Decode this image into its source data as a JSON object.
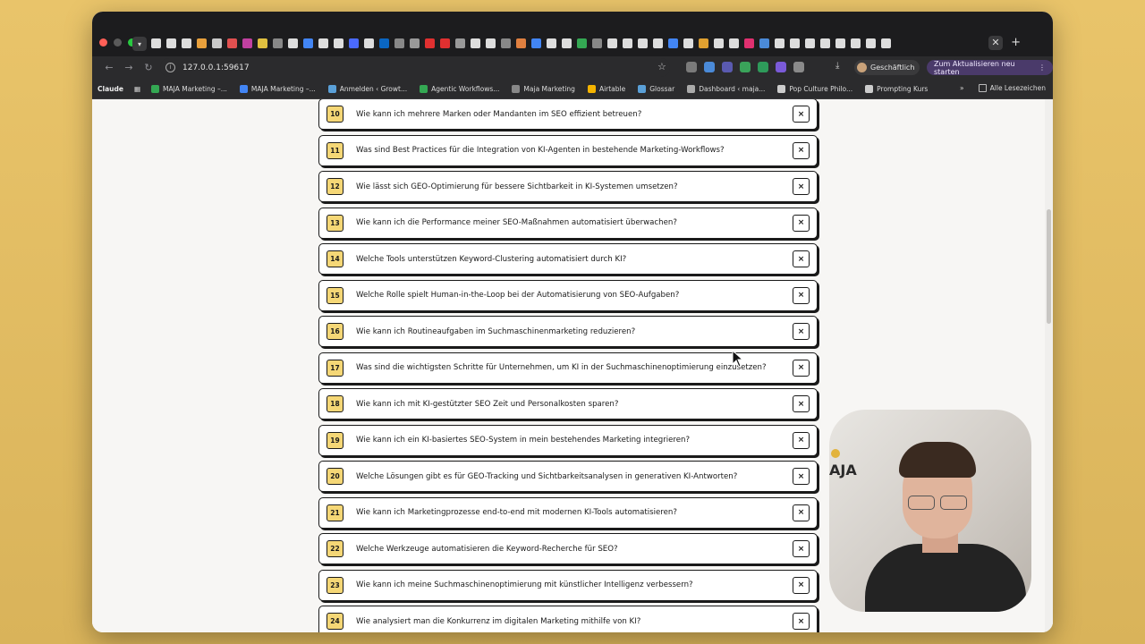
{
  "browser": {
    "address": "127.0.0.1:59617",
    "profile_label": "Geschäftlich",
    "update_label": "Zum Aktualisieren neu starten",
    "bookmarks": [
      {
        "label": "MAJA Marketing –...",
        "color": "#34a853"
      },
      {
        "label": "MAJA Marketing –...",
        "color": "#4285f4"
      },
      {
        "label": "Anmelden ‹ Growt...",
        "color": "#5aa0d8"
      },
      {
        "label": "Agentic Workflows...",
        "color": "#34a853"
      },
      {
        "label": "Maja Marketing",
        "color": "#888888"
      },
      {
        "label": "Airtable",
        "color": "#f5b400"
      },
      {
        "label": "Glossar",
        "color": "#5aa0d8"
      },
      {
        "label": "Dashboard ‹ maja...",
        "color": "#aaaaaa"
      },
      {
        "label": "Pop Culture Philo...",
        "color": "#cccccc"
      },
      {
        "label": "Prompting Kurs",
        "color": "#cccccc"
      }
    ],
    "bookmark_first": "Claude",
    "bookmarks_more": "»",
    "bookmarks_all": "Alle Lesezeichen"
  },
  "faq": [
    {
      "num": "10",
      "question": "Wie kann ich mehrere Marken oder Mandanten im SEO effizient betreuen?"
    },
    {
      "num": "11",
      "question": "Was sind Best Practices für die Integration von KI-Agenten in bestehende Marketing-Workflows?"
    },
    {
      "num": "12",
      "question": "Wie lässt sich GEO-Optimierung für bessere Sichtbarkeit in KI-Systemen umsetzen?"
    },
    {
      "num": "13",
      "question": "Wie kann ich die Performance meiner SEO-Maßnahmen automatisiert überwachen?"
    },
    {
      "num": "14",
      "question": "Welche Tools unterstützen Keyword-Clustering automatisiert durch KI?"
    },
    {
      "num": "15",
      "question": "Welche Rolle spielt Human-in-the-Loop bei der Automatisierung von SEO-Aufgaben?"
    },
    {
      "num": "16",
      "question": "Wie kann ich Routineaufgaben im Suchmaschinenmarketing reduzieren?"
    },
    {
      "num": "17",
      "question": "Was sind die wichtigsten Schritte für Unternehmen, um KI in der Suchmaschinenoptimierung einzusetzen?"
    },
    {
      "num": "18",
      "question": "Wie kann ich mit KI-gestützter SEO Zeit und Personalkosten sparen?"
    },
    {
      "num": "19",
      "question": "Wie kann ich ein KI-basiertes SEO-System in mein bestehendes Marketing integrieren?"
    },
    {
      "num": "20",
      "question": "Welche Lösungen gibt es für GEO-Tracking und Sichtbarkeitsanalysen in generativen KI-Antworten?"
    },
    {
      "num": "21",
      "question": "Wie kann ich Marketingprozesse end-to-end mit modernen KI-Tools automatisieren?"
    },
    {
      "num": "22",
      "question": "Welche Werkzeuge automatisieren die Keyword-Recherche für SEO?"
    },
    {
      "num": "23",
      "question": "Wie kann ich meine Suchmaschinenoptimierung mit künstlicher Intelligenz verbessern?"
    },
    {
      "num": "24",
      "question": "Wie analysiert man die Konkurrenz im digitalen Marketing mithilfe von KI?"
    }
  ],
  "remove_label": "×",
  "webcam": {
    "wall_text": "AJA"
  }
}
